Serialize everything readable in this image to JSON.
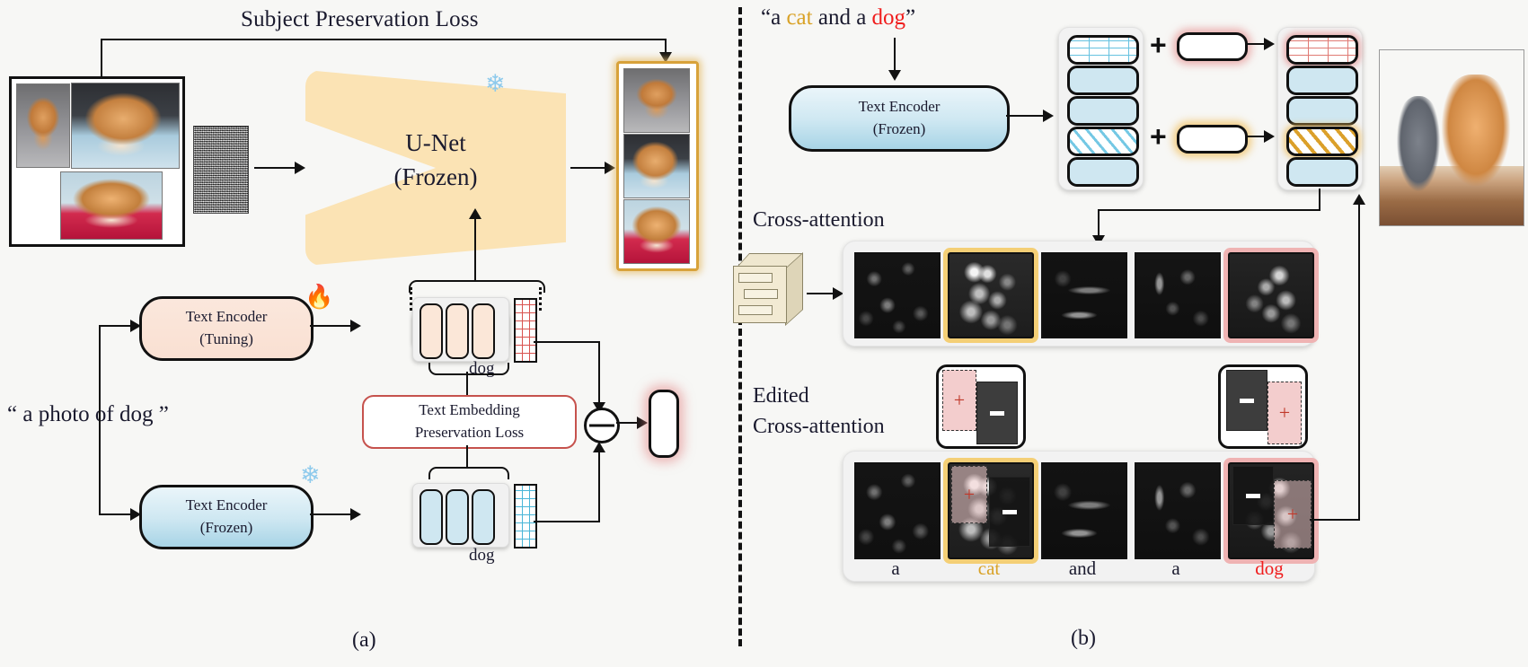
{
  "figure": {
    "panel_a_caption": "(a)",
    "panel_b_caption": "(b)"
  },
  "panel_a": {
    "title": "Subject Preservation Loss",
    "prompt": "“ a photo of dog ”",
    "unet": {
      "line1": "U-Net",
      "line2": "(Frozen)",
      "icon": "snowflake-icon",
      "icon_glyph": "❄"
    },
    "noise_block": "gaussian-noise-latent",
    "reference_images_label": "subject-reference-images",
    "encoder_tuning": {
      "line1": "Text Encoder",
      "line2": "(Tuning)",
      "icon": "fire-icon",
      "icon_glyph": "🔥"
    },
    "encoder_frozen": {
      "line1": "Text Encoder",
      "line2": "(Frozen)",
      "icon": "snowflake-icon",
      "icon_glyph": "❄"
    },
    "embedding_label_top": "dog",
    "embedding_label_bottom": "dog",
    "embedding_loss": {
      "line1": "Text Embedding",
      "line2": "Preservation Loss"
    },
    "operator": "subtract",
    "output_label": "generated-subject-images",
    "residual_label": "residual-embedding"
  },
  "panel_b": {
    "prompt_parts": [
      {
        "text": "“a ",
        "color": "#1a1a2e"
      },
      {
        "text": "cat",
        "color": "#d9a227"
      },
      {
        "text": " and a ",
        "color": "#1a1a2e"
      },
      {
        "text": "dog",
        "color": "#f01c1c"
      },
      {
        "text": "”",
        "color": "#1a1a2e"
      }
    ],
    "encoder_frozen": {
      "line1": "Text Encoder",
      "line2": "(Frozen)"
    },
    "plus_symbol": "+",
    "cross_attention_label": "Cross-attention",
    "edited_cross_attention_label_line1": "Edited",
    "edited_cross_attention_label_line2": "Cross-attention",
    "tokens": [
      {
        "label": "a",
        "color": "#1a1a2e"
      },
      {
        "label": "cat",
        "color": "#d9a227"
      },
      {
        "label": "and",
        "color": "#1a1a2e"
      },
      {
        "label": "a",
        "color": "#1a1a2e"
      },
      {
        "label": "dog",
        "color": "#f01c1c"
      }
    ],
    "mask_plus": "+",
    "mask_minus": "−",
    "unet_icon": "unet-block-icon",
    "generated_image_label": "generated-cat-and-dog-image"
  },
  "colors": {
    "accent_cat": "#d9a227",
    "accent_dog": "#f01c1c",
    "loss_border": "#c6524d",
    "unet_fill": "#fbe3b4",
    "frozen_fill": "#cfe8f2",
    "tuning_fill": "#fbe7dc",
    "ink": "#1a1a2e"
  }
}
